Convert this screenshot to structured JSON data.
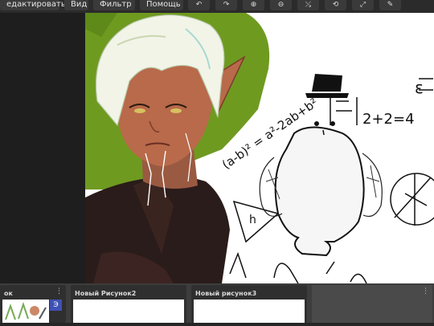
{
  "menu": {
    "edit": "едактировать",
    "view": "Вид",
    "filter": "Фильтр",
    "help": "Помощь"
  },
  "tools": [
    {
      "icon": "undo-icon",
      "glyph": "↶"
    },
    {
      "icon": "redo-icon",
      "glyph": "↷"
    },
    {
      "icon": "zoom-in-icon",
      "glyph": "⊕"
    },
    {
      "icon": "zoom-out-icon",
      "glyph": "⊖"
    },
    {
      "icon": "mirror-icon",
      "glyph": "⤯"
    },
    {
      "icon": "rotate-icon",
      "glyph": "⟲"
    },
    {
      "icon": "fit-icon",
      "glyph": "⤢"
    },
    {
      "icon": "draw-icon",
      "glyph": "✎"
    }
  ],
  "canvas": {
    "math": {
      "equation": "2+2=4",
      "square_formula": "(a-b)² = a²-2ab+b²",
      "triangle_label": "h",
      "misc": "ε"
    }
  },
  "thumbnails": [
    {
      "title": "ок",
      "badge": "Э",
      "menu": "⋮"
    },
    {
      "title": "Новый Рисунок2"
    },
    {
      "title": "Новый рисунок3"
    },
    {
      "title": "",
      "menu": "⋮"
    }
  ],
  "colors": {
    "canvas_bg": "#ffffff",
    "accent": "#3f51b5",
    "hair": "#f2f4e8",
    "green_bg": "#6f9a20"
  }
}
